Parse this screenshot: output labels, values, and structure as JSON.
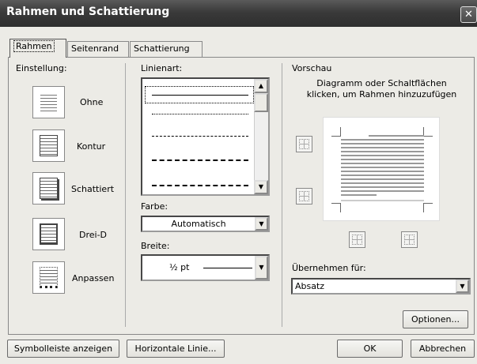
{
  "window": {
    "title": "Rahmen und Schattierung",
    "close_glyph": "✕"
  },
  "tabs": [
    {
      "label": "Rahmen",
      "active": true
    },
    {
      "label": "Seitenrand",
      "active": false
    },
    {
      "label": "Schattierung",
      "active": false
    }
  ],
  "settings": {
    "heading": "Einstellung:",
    "options": [
      "Ohne",
      "Kontur",
      "Schattiert",
      "Drei-D",
      "Anpassen"
    ]
  },
  "line_style": {
    "label": "Linienart:",
    "options": [
      "solid",
      "dotted",
      "dashed-fine",
      "dashed",
      "dash-dot"
    ],
    "selected": "solid"
  },
  "color": {
    "label": "Farbe:",
    "value": "Automatisch"
  },
  "width": {
    "label": "Breite:",
    "value": "½ pt"
  },
  "preview": {
    "heading": "Vorschau",
    "instructions": "Diagramm oder Schaltflächen\nklicken, um Rahmen hinzuzufügen"
  },
  "apply_to": {
    "label": "Übernehmen für:",
    "value": "Absatz"
  },
  "buttons": {
    "options": "Optionen...",
    "toolbar": "Symbolleiste anzeigen",
    "horizontal_line": "Horizontale Linie...",
    "ok": "OK",
    "cancel": "Abbrechen"
  }
}
